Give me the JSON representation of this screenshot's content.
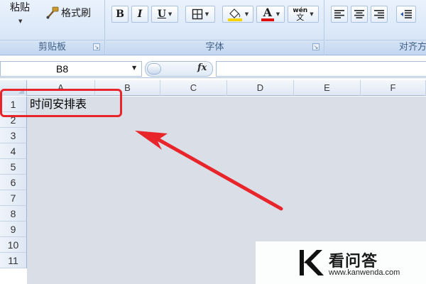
{
  "ribbon": {
    "clipboard": {
      "paste_label": "粘贴",
      "format_painter_label": "格式刷",
      "group_label": "剪贴板"
    },
    "font": {
      "bold_label": "B",
      "italic_label": "I",
      "underline_label": "U",
      "font_color_label": "A",
      "phonetic_top": "wén",
      "phonetic_bottom": "文",
      "group_label": "字体"
    },
    "alignment": {
      "group_label": "对齐方"
    }
  },
  "formula_bar": {
    "name_box_value": "B8",
    "fx_label": "fx"
  },
  "grid": {
    "columns": [
      "A",
      "B",
      "C",
      "D",
      "E",
      "F"
    ],
    "rows": [
      "1",
      "2",
      "3",
      "4",
      "5",
      "6",
      "7",
      "8",
      "9",
      "10",
      "11"
    ],
    "cell_a1": "时间安排表"
  },
  "watermark": {
    "title": "看问答",
    "url": "www.kanwenda.com"
  },
  "colors": {
    "annotation_red": "#e8252b",
    "fill_yellow": "#f7d300",
    "font_red": "#e01010"
  }
}
